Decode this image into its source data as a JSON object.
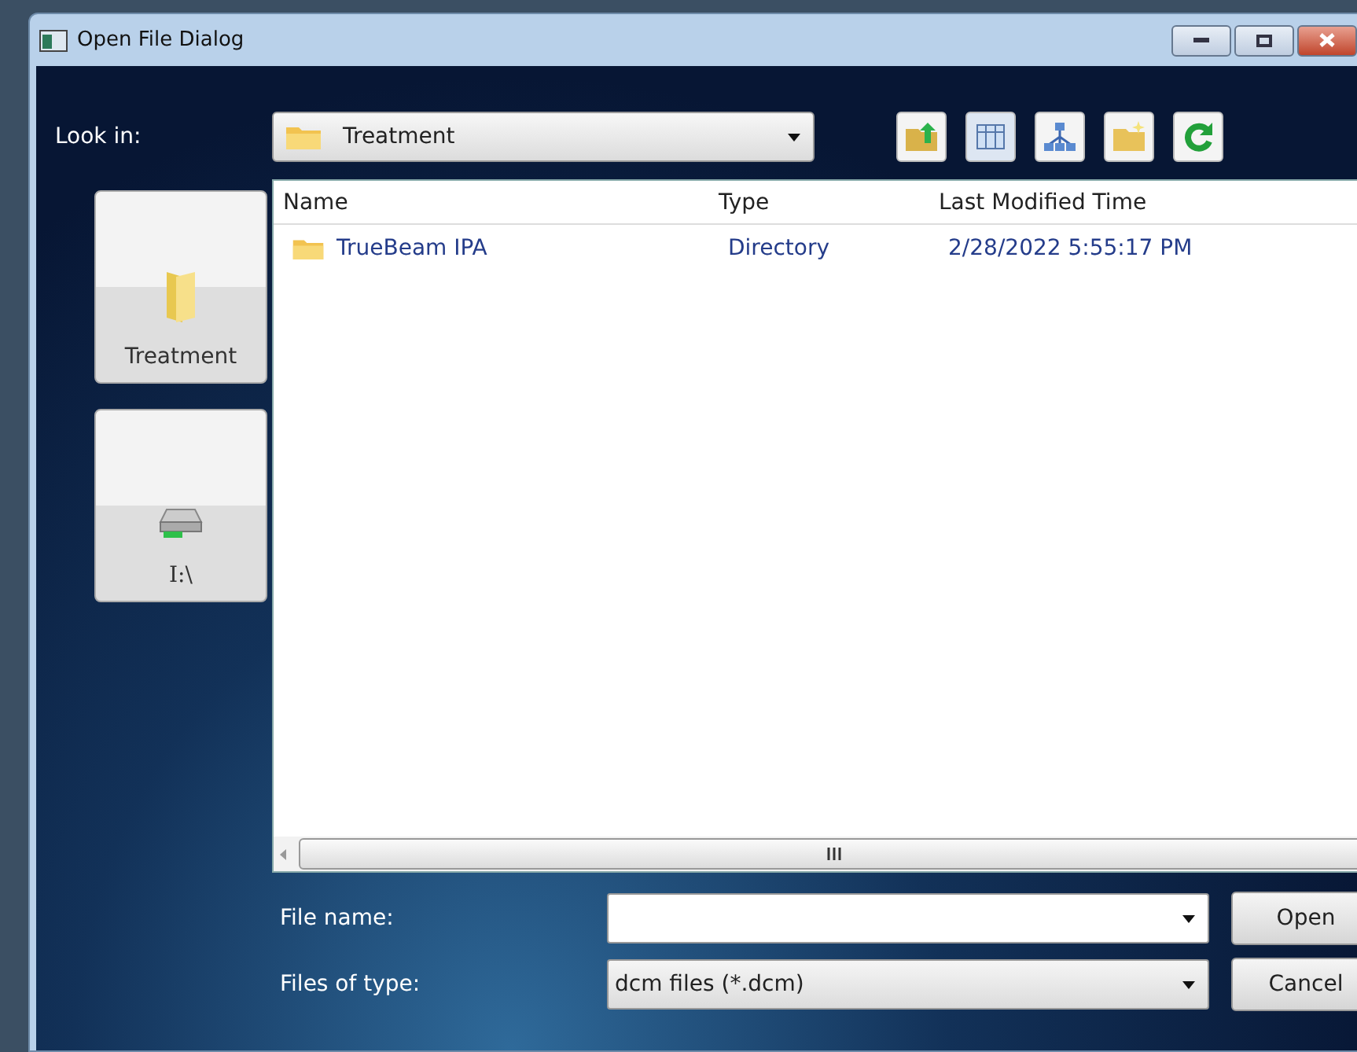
{
  "window": {
    "title": "Open File Dialog"
  },
  "look_in": {
    "label": "Look in:",
    "value": "Treatment"
  },
  "toolbar": [
    {
      "kind": "up"
    },
    {
      "kind": "view"
    },
    {
      "kind": "tree"
    },
    {
      "kind": "new-folder"
    },
    {
      "kind": "refresh"
    }
  ],
  "places": [
    {
      "kind": "folder",
      "label": "Treatment"
    },
    {
      "kind": "drive",
      "label": "I:\\"
    }
  ],
  "table": {
    "columns": [
      "Name",
      "Type",
      "Last Modified Time"
    ],
    "rows": [
      {
        "name": "TrueBeam IPA",
        "type": "Directory",
        "modified": "2/28/2022 5:55:17 PM"
      }
    ]
  },
  "file_name": {
    "label": "File name:"
  },
  "file_type": {
    "label": "Files of type:",
    "value": "dcm files (*.dcm)"
  },
  "buttons": [
    "Open",
    "Cancel"
  ]
}
